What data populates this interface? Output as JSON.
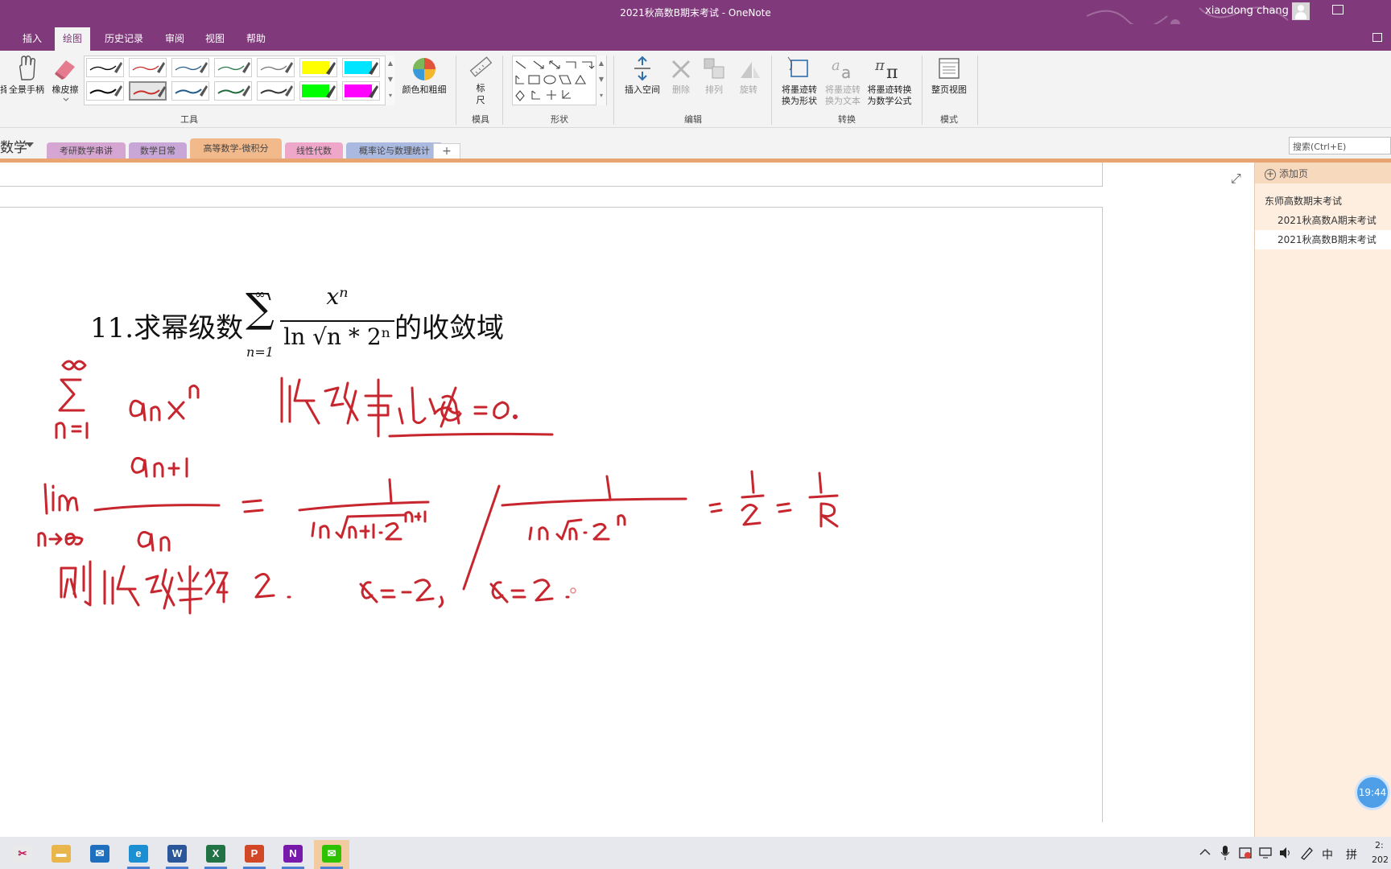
{
  "window": {
    "title": "2021秋高数B期末考试  -  OneNote",
    "user": "xiaodong chang"
  },
  "ribbon_tabs": [
    {
      "label": "插入",
      "active": false
    },
    {
      "label": "绘图",
      "active": true
    },
    {
      "label": "历史记录",
      "active": false
    },
    {
      "label": "审阅",
      "active": false
    },
    {
      "label": "视图",
      "active": false
    },
    {
      "label": "帮助",
      "active": false
    }
  ],
  "ribbon": {
    "partial_select_label": "择",
    "pan_label": "全景手柄",
    "eraser_label": "橡皮擦",
    "color_thickness_label": "颜色和粗细",
    "ruler_label_top": "标",
    "ruler_label_bottom": "尺",
    "insert_space_label": "插入空间",
    "delete_label": "删除",
    "arrange_label": "排列",
    "rotate_label": "旋转",
    "ink_to_shape_l1": "将墨迹转",
    "ink_to_shape_l2": "换为形状",
    "ink_to_text_l1": "将墨迹转",
    "ink_to_text_l2": "换为文本",
    "ink_to_math_l1": "将墨迹转换",
    "ink_to_math_l2": "为数学公式",
    "full_page_label": "整页视图",
    "groups": {
      "tools": "工具",
      "stencils": "模具",
      "shapes": "形状",
      "edit": "编辑",
      "convert": "转换",
      "mode": "模式"
    },
    "pens_row1": [
      "#000000",
      "#c8302b",
      "#2b5f8a",
      "#2f7a4b",
      "#777777",
      "#ffff00",
      "#00e5ff"
    ],
    "pens_row2": [
      "#000000",
      "#c8302b",
      "#1f5a8a",
      "#1f6b3c",
      "#333333",
      "#00ff00",
      "#ff00ff"
    ]
  },
  "notebook": {
    "name": "数学",
    "sections": [
      {
        "label": "考研数学串讲",
        "color": "#d6a6d3",
        "active": false
      },
      {
        "label": "数学日常",
        "color": "#c9a6d8",
        "active": false
      },
      {
        "label": "高等数学-微积分",
        "color": "#f2b98a",
        "active": true
      },
      {
        "label": "线性代数",
        "color": "#efa7c9",
        "active": false
      },
      {
        "label": "概率论与数理统计",
        "color": "#a9b9e0",
        "active": false
      }
    ],
    "add_section": "+",
    "search_placeholder": "搜索(Ctrl+E)"
  },
  "page": {
    "problem_lead": "11.求幂级数",
    "sum_upper": "∞",
    "sum_lower": "n=1",
    "numerator": "xⁿ",
    "denominator": "ln √n * 2ⁿ",
    "problem_trail": "的收敛域"
  },
  "page_panel": {
    "add_page": "添加页",
    "pages": [
      {
        "label": "东师高数期末考试",
        "indent": 0,
        "selected": false
      },
      {
        "label": "2021秋高数A期末考试",
        "indent": 1,
        "selected": false
      },
      {
        "label": "2021秋高数B期末考试",
        "indent": 1,
        "selected": true
      }
    ]
  },
  "overlay_clock": "19:44",
  "taskbar": {
    "apps": [
      {
        "name": "snip",
        "color": "#e9e9e9",
        "glyph": "✂",
        "running": false,
        "active": false
      },
      {
        "name": "explorer",
        "color": "#e8b64a",
        "glyph": "▬",
        "running": false,
        "active": false
      },
      {
        "name": "mail",
        "color": "#1f6fbf",
        "glyph": "✉",
        "running": false,
        "active": false
      },
      {
        "name": "edge",
        "color": "#1b8fd1",
        "glyph": "e",
        "running": true,
        "active": false
      },
      {
        "name": "word",
        "color": "#2b579a",
        "glyph": "W",
        "running": true,
        "active": false
      },
      {
        "name": "excel",
        "color": "#217346",
        "glyph": "X",
        "running": true,
        "active": false
      },
      {
        "name": "powerpoint",
        "color": "#d24726",
        "glyph": "P",
        "running": true,
        "active": false
      },
      {
        "name": "onenote",
        "color": "#7719aa",
        "glyph": "N",
        "running": true,
        "active": false
      },
      {
        "name": "wechat",
        "color": "#2dc100",
        "glyph": "✉",
        "running": true,
        "active": true
      }
    ],
    "ime_lang": "中",
    "ime_mode": "拼",
    "clock_fragment_top": "2:",
    "clock_fragment_bottom": "202"
  }
}
